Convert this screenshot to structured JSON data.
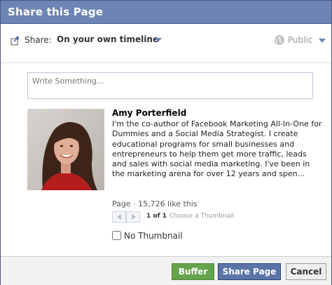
{
  "dialog": {
    "title": "Share this Page"
  },
  "share": {
    "label": "Share:",
    "target": "On your own timeline",
    "privacy": "Public"
  },
  "composer": {
    "placeholder": "Write Something..."
  },
  "attachment": {
    "name": "Amy Porterfield",
    "description": "I'm the co-author of Facebook Marketing All-In-One for Dummies and a Social Media Strategist. I create educational programs for small businesses and entrepreneurs to help them get more traffic, leads and sales with social media marketing. I've been in the marketing arena for over 12 years and spen...",
    "meta": "Page · 15,726 like this",
    "thumbnail_pager": {
      "count": "1 of 1",
      "choose": "Choose a Thumbnail"
    },
    "no_thumbnail_label": "No Thumbnail"
  },
  "footer": {
    "buffer_label": "Buffer",
    "share_label": "Share Page",
    "cancel_label": "Cancel"
  },
  "colors": {
    "titlebar": "#6d84b4",
    "buffer_button": "#65a44c",
    "share_button": "#5b74a8"
  }
}
